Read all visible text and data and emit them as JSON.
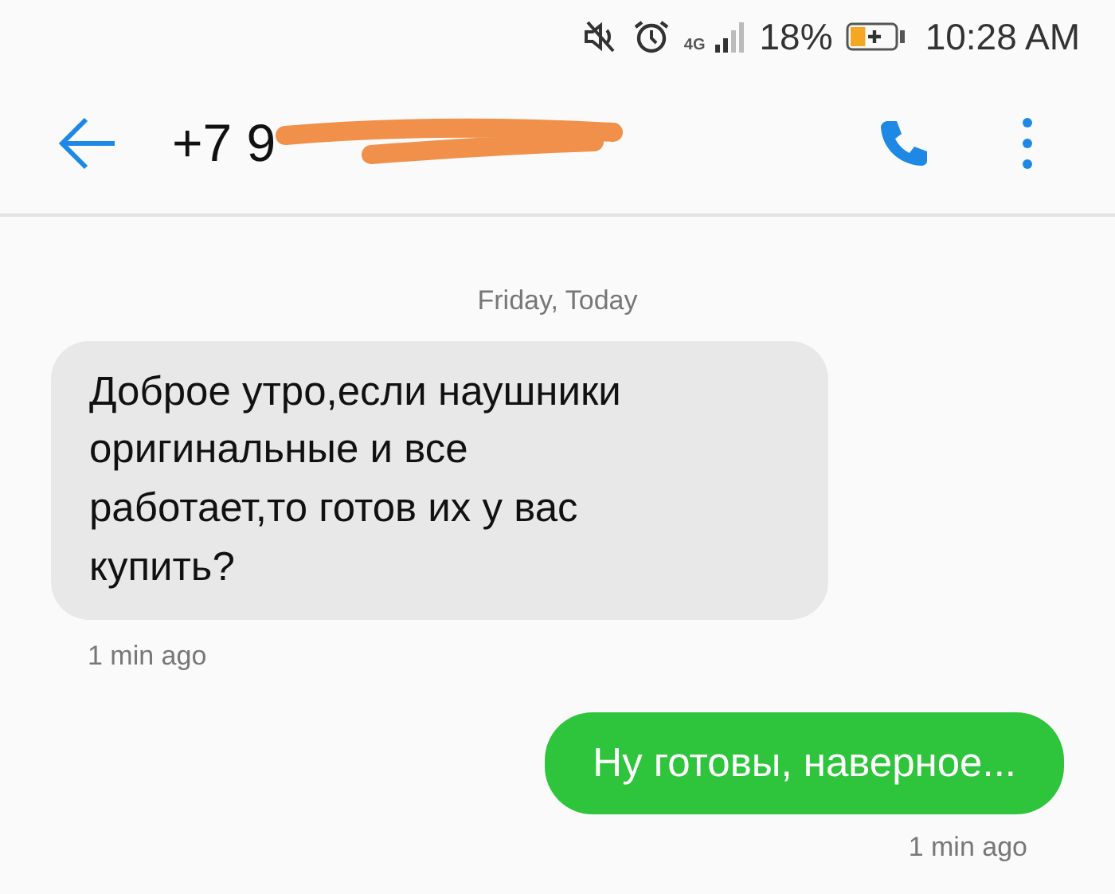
{
  "status_bar": {
    "network": "4G",
    "battery_text": "18%",
    "battery": {
      "charging": true
    },
    "time": "10:28 AM"
  },
  "header": {
    "title": "+7 9",
    "redacted": true
  },
  "date_label": "Friday, Today",
  "messages": [
    {
      "kind": "incoming",
      "text": "Доброе утро,если наушники оригинальные и все работает,то готов их у вас купить?",
      "time": "1 min ago"
    },
    {
      "kind": "outgoing",
      "text": "Ну готовы, наверное...",
      "time": "1 min ago"
    }
  ]
}
